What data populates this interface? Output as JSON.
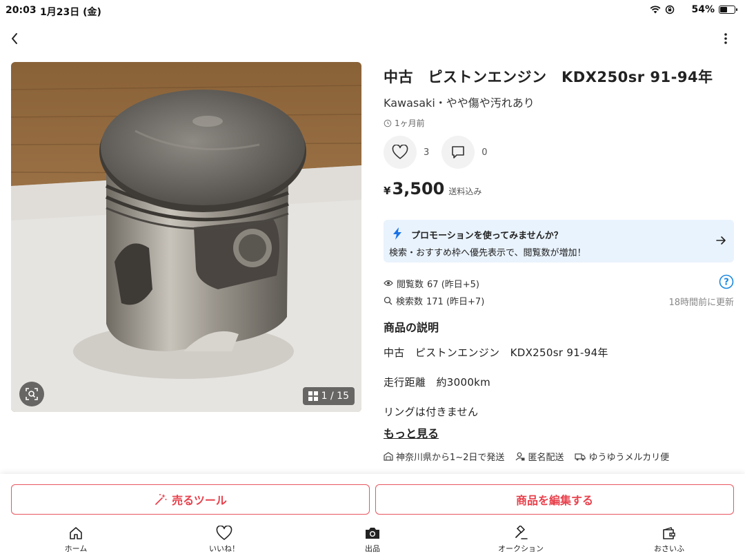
{
  "status_bar": {
    "time": "20:03",
    "date": "1月23日 (金)",
    "battery": "54%",
    "battery_level": 0.54
  },
  "item": {
    "title": "中古　ピストンエンジン　KDX250sr 91-94年",
    "subtitle": "Kawasaki・やや傷や汚れあり",
    "posted": "1ヶ月前",
    "likes": "3",
    "comments": "0",
    "price_symbol": "¥",
    "price": "3,500",
    "shipping": "送料込み",
    "photo_counter": "1 / 15"
  },
  "promo": {
    "title": "プロモーションを使ってみませんか？",
    "description": "検索・おすすめ枠へ優先表示で、閲覧数が増加！"
  },
  "stats": {
    "views": "閲覧数",
    "views_value": "67 (昨日+5)",
    "searches": "検索数",
    "searches_value": "171 (昨日+7)",
    "updated": "18時間前に更新"
  },
  "description": {
    "heading": "商品の説明",
    "lines": [
      "中古　ピストンエンジン　KDX250sr  91-94年",
      "走行距離　約3000km",
      "リングは付きません"
    ],
    "more": "もっと見る"
  },
  "shipping_info": {
    "origin": "神奈川県から1~2日で発送",
    "anonymous": "匿名配送",
    "method": "ゆうゆうメルカリ便"
  },
  "actions": {
    "sell_tool": "売るツール",
    "edit": "商品を編集する"
  },
  "tabs": [
    {
      "label": "ホーム",
      "icon": "home-icon"
    },
    {
      "label": "いいね！",
      "icon": "heart-icon"
    },
    {
      "label": "出品",
      "icon": "camera-icon"
    },
    {
      "label": "オークション",
      "icon": "gavel-icon"
    },
    {
      "label": "おさいふ",
      "icon": "wallet-icon"
    }
  ],
  "colors": {
    "accent_red": "#e8414c",
    "promo_bg": "#e9f3fd",
    "promo_bolt": "#1a73e8",
    "help_blue": "#1a88e0"
  }
}
